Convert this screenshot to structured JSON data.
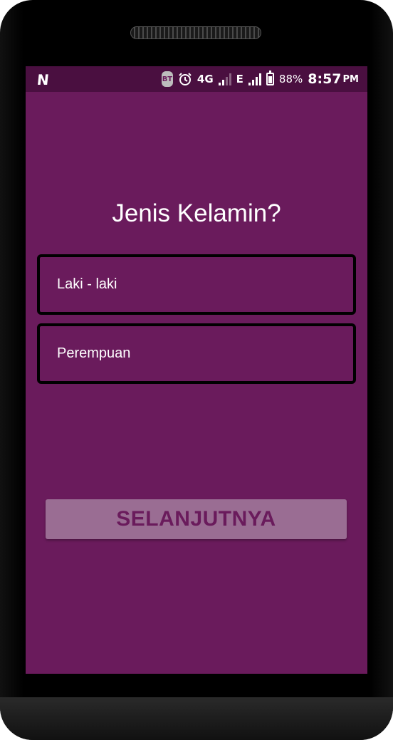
{
  "status_bar": {
    "notification_icon": "N",
    "bt_label": "BT",
    "network_label": "4G",
    "network2_label": "E",
    "battery_percent": "88%",
    "time": "8:57",
    "ampm": "PM"
  },
  "screen": {
    "title": "Jenis Kelamin?",
    "options": [
      {
        "label": "Laki - laki"
      },
      {
        "label": "Perempuan"
      }
    ],
    "next_button_label": "SELANJUTNYA"
  },
  "colors": {
    "background": "#6a1b5c",
    "statusbar": "#4a0f40",
    "button_bg": "#9a6d93",
    "button_text": "#6a1b5c",
    "option_border": "#000000"
  },
  "icons": [
    "notification-n-icon",
    "bluetooth-icon",
    "alarm-icon",
    "signal-icon",
    "battery-icon"
  ]
}
